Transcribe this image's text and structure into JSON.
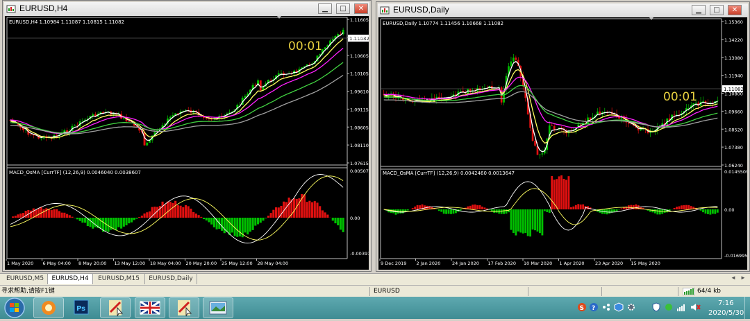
{
  "windows": [
    {
      "id": "h4",
      "title": "EURUSD,H4",
      "quote": "EURUSD,H4  1.10984 1.11087 1.10815 1.11082",
      "timer": "00:01",
      "price_tag": "1.11082",
      "price_axis": [
        "1.11605",
        "1.11082",
        "1.10605",
        "1.10105",
        "1.09610",
        "1.09115",
        "1.08605",
        "1.08110",
        "1.07615"
      ],
      "indicator_label": "MACD_OsMA [CurrTF] (12,26,9) 0.0046040 0.0038607",
      "indicator_axis": [
        "0.0050736",
        "0.00",
        "-0.003913"
      ],
      "time_axis": [
        "1 May 2020",
        "6 May 04:00",
        "8 May 20:00",
        "13 May 12:00",
        "18 May 04:00",
        "20 May 20:00",
        "25 May 12:00",
        "28 May 04:00"
      ]
    },
    {
      "id": "daily",
      "title": "EURUSD,Daily",
      "quote": "EURUSD,Daily  1.10774 1.11456 1.10668 1.11082",
      "timer": "00:01",
      "price_tag": "1.11082",
      "price_axis": [
        "1.15360",
        "1.14220",
        "1.13080",
        "1.11940",
        "1.10800",
        "1.09660",
        "1.08520",
        "1.07380",
        "1.06240"
      ],
      "indicator_label": "MACD_OsMA [CurrTF] (12,26,9) 0.0042460 0.0013647",
      "indicator_axis": [
        "0.0145509",
        "0.00",
        "-0.016995"
      ],
      "time_axis": [
        "9 Dec 2019",
        "2 Jan 2020",
        "24 Jan 2020",
        "17 Feb 2020",
        "10 Mar 2020",
        "1 Apr 2020",
        "23 Apr 2020",
        "15 May 2020"
      ]
    }
  ],
  "tabs": [
    "EURUSD,M5",
    "EURUSD,H4",
    "EURUSD,M15",
    "EURUSD,Daily"
  ],
  "active_tab": "EURUSD,H4",
  "status": {
    "help": "寻求帮助,请按F1键",
    "profile": "EURUSD",
    "traffic": "64/4 kb"
  },
  "clock": {
    "time": "7:16",
    "date": "2020/5/30"
  },
  "colors": {
    "bull": "#00c000",
    "bear": "#e01010",
    "ma_white": "#ffffff",
    "ma_yellow": "#ffff60",
    "ma_magenta": "#ff20ff",
    "ma_green": "#40d040",
    "ma_gray": "#a0a0a0",
    "timer": "#e8d040"
  }
}
